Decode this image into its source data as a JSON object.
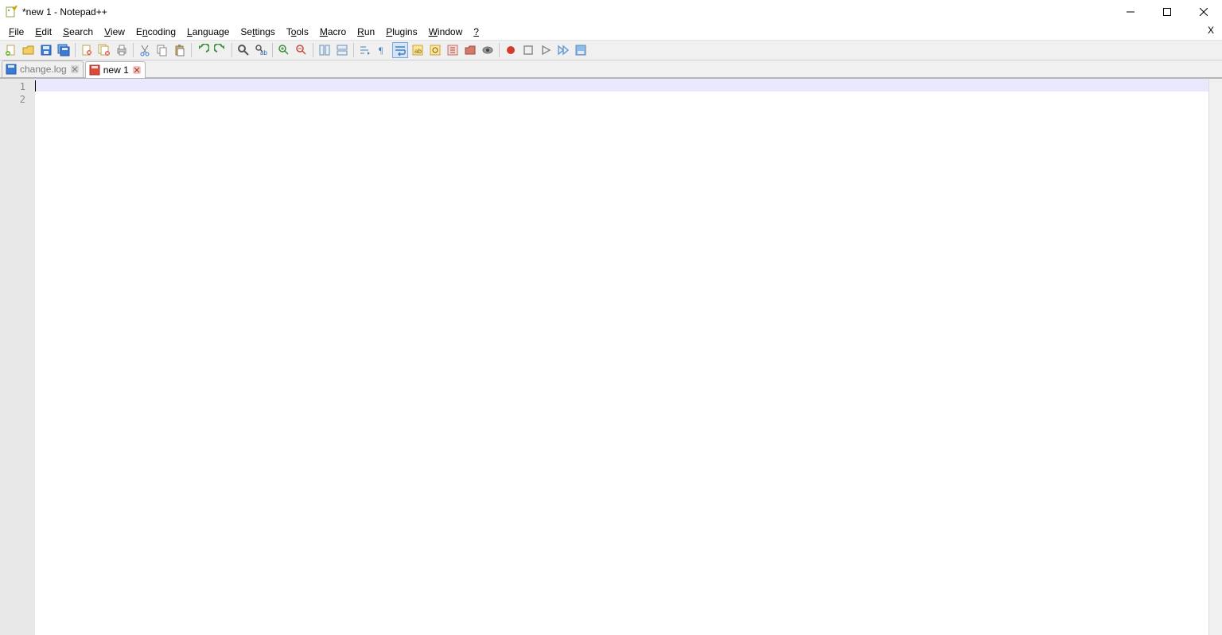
{
  "window": {
    "title": "*new 1 - Notepad++"
  },
  "menus": {
    "file": {
      "prefix": "",
      "ul": "F",
      "rest": "ile"
    },
    "edit": {
      "prefix": "",
      "ul": "E",
      "rest": "dit"
    },
    "search": {
      "prefix": "",
      "ul": "S",
      "rest": "earch"
    },
    "view": {
      "prefix": "",
      "ul": "V",
      "rest": "iew"
    },
    "encoding": {
      "prefix": "E",
      "ul": "n",
      "rest": "coding"
    },
    "language": {
      "prefix": "",
      "ul": "L",
      "rest": "anguage"
    },
    "settings": {
      "prefix": "Se",
      "ul": "t",
      "rest": "tings"
    },
    "tools": {
      "prefix": "T",
      "ul": "o",
      "rest": "ols"
    },
    "macro": {
      "prefix": "",
      "ul": "M",
      "rest": "acro"
    },
    "run": {
      "prefix": "",
      "ul": "R",
      "rest": "un"
    },
    "plugins": {
      "prefix": "",
      "ul": "P",
      "rest": "lugins"
    },
    "windowm": {
      "prefix": "",
      "ul": "W",
      "rest": "indow"
    },
    "help": {
      "prefix": "",
      "ul": "?",
      "rest": ""
    }
  },
  "menubar_close_x": "X",
  "tabs": {
    "inactive_label": "change.log",
    "active_label": "new 1"
  },
  "editor": {
    "line_numbers": [
      "1",
      "2"
    ]
  }
}
